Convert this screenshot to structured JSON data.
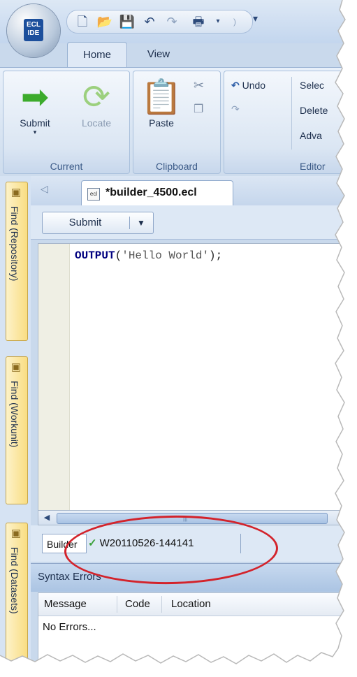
{
  "app": {
    "logo_text": "ECL IDE"
  },
  "quick_access": {
    "icons": [
      "new-file-icon",
      "open-folder-icon",
      "save-icon",
      "undo-icon",
      "redo-icon",
      "print-icon"
    ],
    "overflow_glyph": "▾"
  },
  "ribbon_tabs": [
    {
      "label": "Home",
      "active": true
    },
    {
      "label": "View",
      "active": false
    }
  ],
  "ribbon": {
    "current": {
      "submit_label": "Submit",
      "locate_label": "Locate",
      "group_label": "Current"
    },
    "clipboard": {
      "paste_label": "Paste",
      "group_label": "Clipboard"
    },
    "editor": {
      "undo_label": "Undo",
      "select_label": "Selec",
      "delete_label": "Delete",
      "advanced_label": "Adva",
      "group_label": "Editor"
    }
  },
  "side_panels": [
    {
      "label": "Find (Repository)"
    },
    {
      "label": "Find (Workunit)"
    },
    {
      "label": "Find (Datasets)"
    }
  ],
  "document": {
    "tab_label": "*builder_4500.ecl",
    "submit_button": "Submit",
    "code": {
      "keyword": "OUTPUT",
      "open": "(",
      "string": "'Hello World'",
      "close": ");"
    }
  },
  "results_tabs": {
    "builder_label": "Builder",
    "workunit_label": "W20110526-144141",
    "workunit_status": "completed",
    "check_glyph": "✓"
  },
  "syntax_errors": {
    "title": "Syntax Errors",
    "columns": [
      "Message",
      "Code",
      "Location"
    ],
    "rows": [
      "No Errors..."
    ]
  },
  "colors": {
    "annotation_ring": "#d3232b",
    "keyword": "#00007f",
    "dock_tab": "#f9dd82"
  }
}
